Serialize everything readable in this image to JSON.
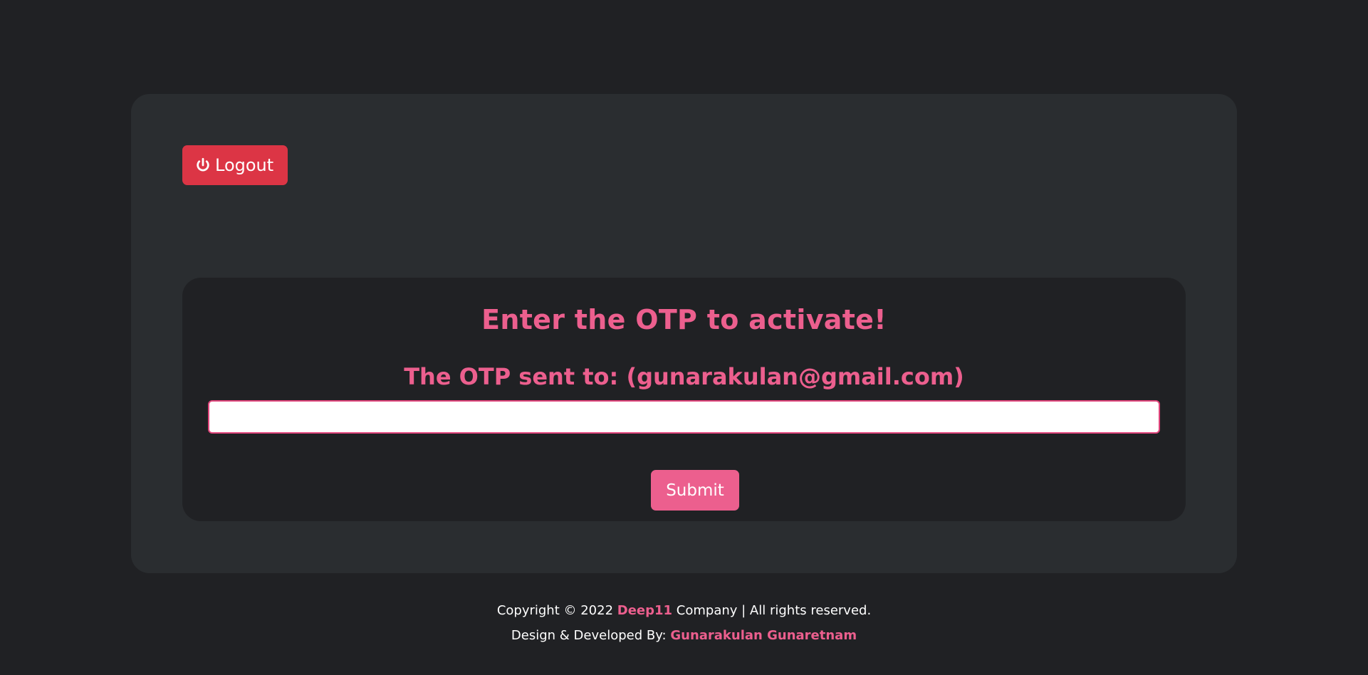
{
  "header": {
    "logout_label": "Logout",
    "logout_icon": "power-icon"
  },
  "otp_panel": {
    "title": "Enter the OTP to activate!",
    "sent_to": "The OTP sent to: (gunarakulan@gmail.com)",
    "input_value": "",
    "input_placeholder": "",
    "submit_label": "Submit"
  },
  "footer": {
    "copyright_prefix": "Copyright © 2022",
    "company_name": "Deep11",
    "copyright_suffix": "Company | All rights reserved.",
    "developer_prefix": "Design & Developed By:",
    "developer_name": "Gunarakulan Gunaretnam"
  },
  "colors": {
    "background": "#202124",
    "card": "#2a2d30",
    "accent": "#ec5f8e",
    "danger": "#dc3545"
  }
}
